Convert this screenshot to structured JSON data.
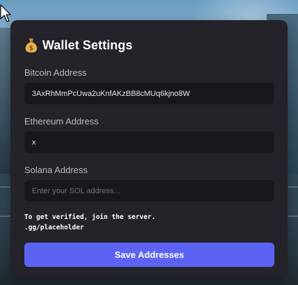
{
  "dialog": {
    "title": "Wallet Settings",
    "title_icon": "money-bag-icon"
  },
  "fields": {
    "bitcoin": {
      "label": "Bitcoin Address",
      "value": "3AxRhMmPcUwa2uKnfAKzBB8cMUq6kjno8W",
      "placeholder": ""
    },
    "ethereum": {
      "label": "Ethereum Address",
      "value": "x",
      "placeholder": ""
    },
    "solana": {
      "label": "Solana Address",
      "value": "",
      "placeholder": "Enter your SOL address..."
    }
  },
  "note": {
    "line1": "To get verified, join the server.",
    "line2": ".gg/placeholder"
  },
  "save_button": {
    "label": "Save Addresses"
  },
  "colors": {
    "panel": "#232329",
    "input": "#18181c",
    "accent": "#5c63f2"
  }
}
